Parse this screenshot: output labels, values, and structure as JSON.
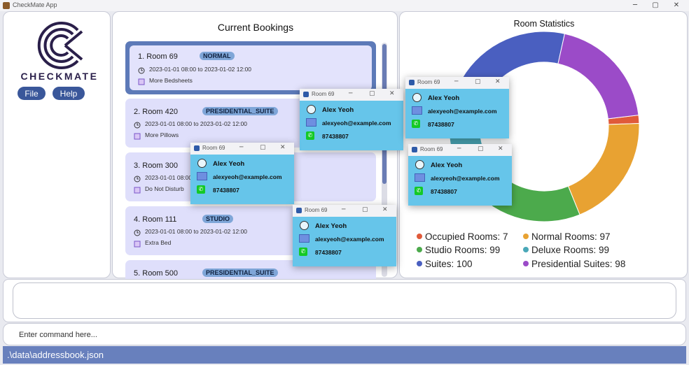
{
  "app": {
    "title": "CheckMate App",
    "brand": "CHECKMATE"
  },
  "window_controls": {
    "minimize": "─",
    "maximize": "▢",
    "close": "✕"
  },
  "menu": {
    "file": "File",
    "help": "Help"
  },
  "bookings": {
    "title": "Current Bookings",
    "items": [
      {
        "index": "1.",
        "room": "Room 69",
        "type": "NORMAL",
        "period": "2023-01-01 08:00 to 2023-01-02 12:00",
        "request": "More Bedsheets",
        "selected": true
      },
      {
        "index": "2.",
        "room": "Room 420",
        "type": "PRESIDENTIAL_SUITE",
        "period": "2023-01-01 08:00 to 2023-01-02 12:00",
        "request": "More Pillows"
      },
      {
        "index": "3.",
        "room": "Room 300",
        "type": "",
        "period": "2023-01-01 08:00",
        "request": "Do Not Disturb"
      },
      {
        "index": "4.",
        "room": "Room 111",
        "type": "STUDIO",
        "period": "2023-01-01 08:00 to 2023-01-02 12:00",
        "request": "Extra Bed"
      },
      {
        "index": "5.",
        "room": "Room 500",
        "type": "PRESIDENTIAL_SUITE"
      }
    ]
  },
  "stats": {
    "title": "Room Statistics",
    "legend": [
      {
        "label": "Occupied Rooms: 7",
        "color": "#e05a3a"
      },
      {
        "label": "Normal Rooms: 97",
        "color": "#e8a232"
      },
      {
        "label": "Studio Rooms: 99",
        "color": "#4caa4c"
      },
      {
        "label": "Deluxe Rooms: 99",
        "color": "#4aa8b8"
      },
      {
        "label": "Suites: 100",
        "color": "#4a5fc0"
      },
      {
        "label": "Presidential Suites: 98",
        "color": "#9b4bc8"
      }
    ]
  },
  "chart_data": {
    "type": "pie",
    "categories": [
      "Occupied Rooms",
      "Normal Rooms",
      "Studio Rooms",
      "Deluxe Rooms",
      "Suites",
      "Presidential Suites"
    ],
    "values": [
      7,
      97,
      99,
      99,
      100,
      98
    ],
    "colors": [
      "#e05a3a",
      "#e8a232",
      "#4caa4c",
      "#4aa8b8",
      "#4a5fc0",
      "#9b4bc8"
    ],
    "title": "Room Statistics",
    "legend_position": "bottom"
  },
  "popup": {
    "window_title": "Room 69",
    "name": "Alex Yeoh",
    "email": "alexyeoh@example.com",
    "phone": "87438807"
  },
  "command": {
    "placeholder": "Enter command here..."
  },
  "status": {
    "path": ".\\data\\addressbook.json"
  }
}
